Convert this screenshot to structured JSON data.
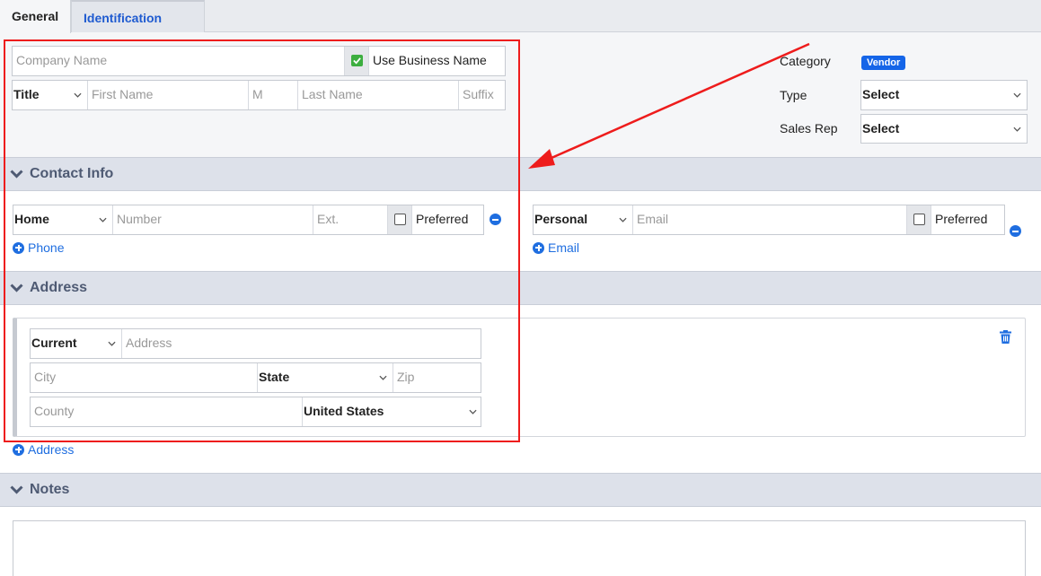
{
  "tabs": {
    "general": "General",
    "identification": "Identification Data"
  },
  "name": {
    "company_placeholder": "Company Name",
    "use_business_label": "Use Business Name",
    "use_business_checked": true,
    "title_value": "Title",
    "first_placeholder": "First Name",
    "middle_placeholder": "M",
    "last_placeholder": "Last Name",
    "suffix_placeholder": "Suffix"
  },
  "side": {
    "category_label": "Category",
    "category_value": "Vendor",
    "type_label": "Type",
    "type_value": "Select",
    "salesrep_label": "Sales Rep",
    "salesrep_value": "Select"
  },
  "contact": {
    "title": "Contact Info",
    "phone_type": "Home",
    "number_placeholder": "Number",
    "ext_placeholder": "Ext.",
    "preferred_label": "Preferred",
    "add_phone": "Phone",
    "email_type": "Personal",
    "email_placeholder": "Email",
    "email_preferred_label": "Preferred",
    "add_email": "Email"
  },
  "address": {
    "title": "Address",
    "type_value": "Current",
    "address_placeholder": "Address",
    "city_placeholder": "City",
    "state_value": "State",
    "zip_placeholder": "Zip",
    "county_placeholder": "County",
    "country_value": "United States",
    "add_address": "Address"
  },
  "notes": {
    "title": "Notes"
  },
  "colors": {
    "accent": "#1f6ee0",
    "highlight": "#ee1c1c",
    "badge": "#1565e8"
  }
}
